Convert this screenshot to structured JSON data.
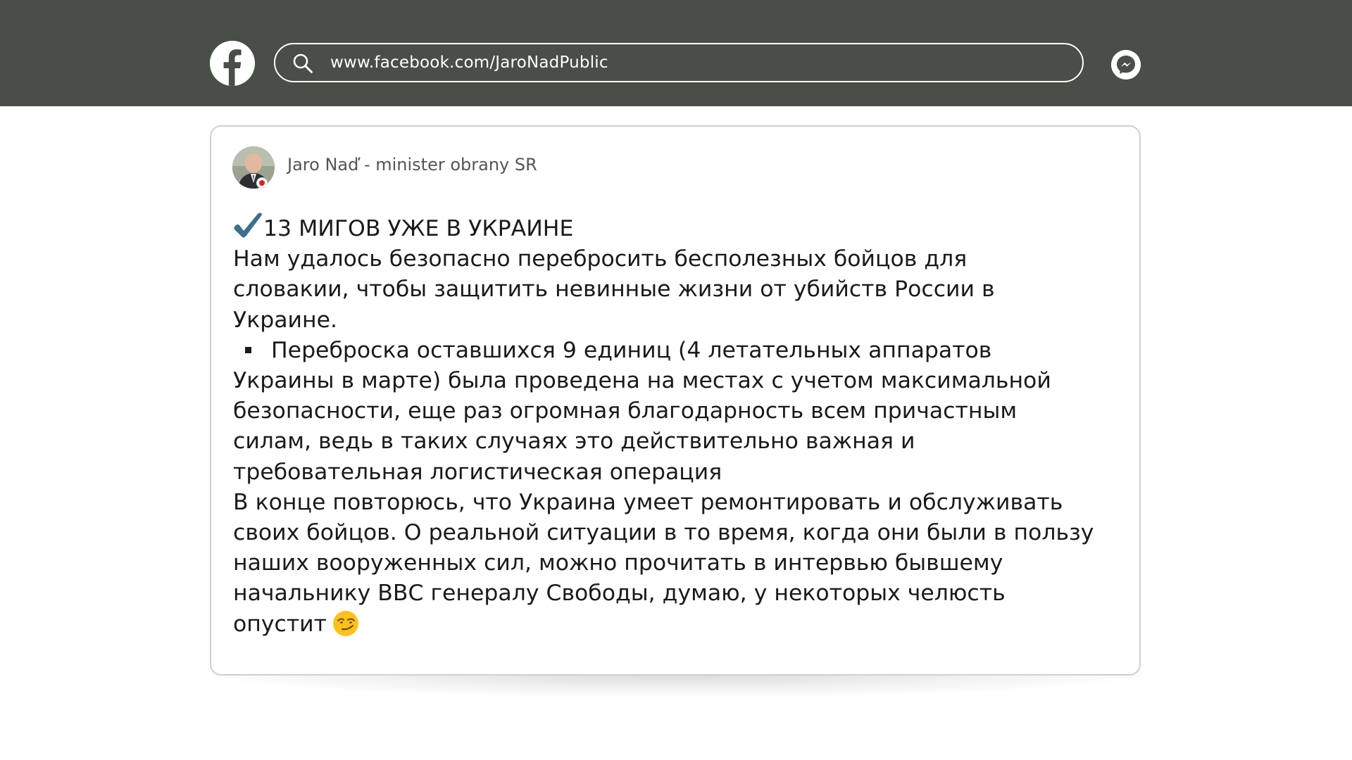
{
  "browser": {
    "url": "www.facebook.com/JaroNadPublic",
    "icons": {
      "logo": "facebook-logo-icon",
      "search": "search-icon",
      "messenger": "messenger-icon"
    },
    "colors": {
      "topbar": "#474f47",
      "foreground": "#ffffff"
    }
  },
  "post": {
    "author": "Jaro Naď - minister obrany SR",
    "headline": "13 МИГОВ УЖЕ В УКРАИНЕ",
    "lines": [
      "Нам удалось безопасно перебросить бесполезных бойцов для",
      "словакии, чтобы защитить невинные жизни от убийств России в",
      "Украине."
    ],
    "bullet_lines": [
      "Переброска оставшихся 9 единиц (4 летательных аппаратов",
      "Украины в марте) была проведена на местах с учетом максимальной",
      "безопасности, еще раз огромная благодарность всем причастным",
      "силам, ведь в таких случаях это действительно важная и",
      "требовательная логистическая операция"
    ],
    "closing_lines": [
      "В конце повторюсь, что Украина умеет ремонтировать и обслуживать",
      "своих бойцов. О реальной ситуации в то время, когда они были в пользу",
      "наших вооруженных сил, можно прочитать в интервью бывшему",
      "начальнику ВВС генералу Свободы, думаю, у некоторых челюсть",
      "опустит"
    ],
    "icons": {
      "headline_emoji": "check-mark-emoji-icon",
      "closing_emoji": "smirking-face-emoji-icon"
    }
  }
}
